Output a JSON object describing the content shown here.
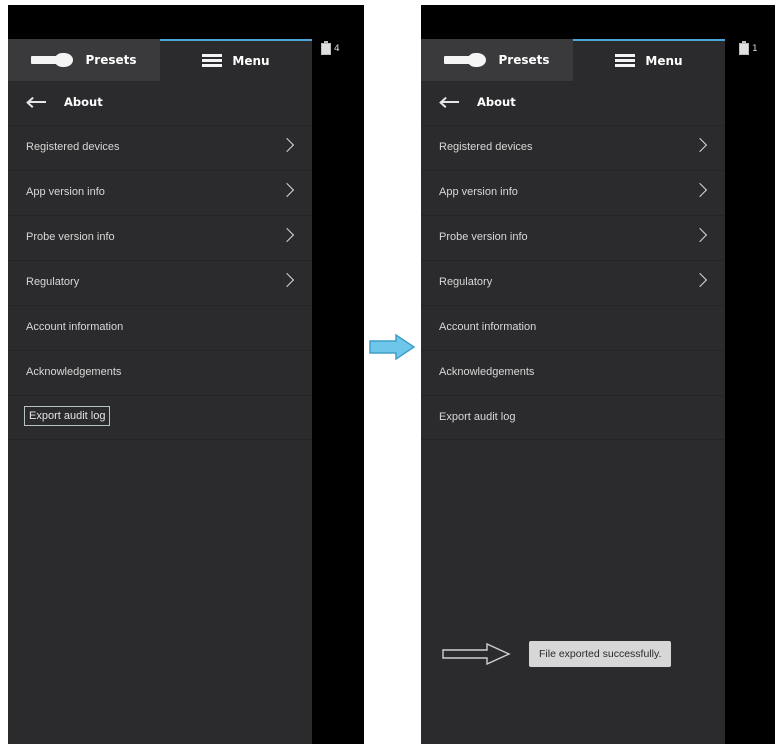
{
  "left_screen": {
    "tabs": {
      "presets_label": "Presets",
      "menu_label": "Menu"
    },
    "badge_count": "4",
    "header": {
      "title": "About"
    },
    "items": [
      {
        "label": "Registered devices",
        "chevron": true
      },
      {
        "label": "App version info",
        "chevron": true
      },
      {
        "label": "Probe version info",
        "chevron": true
      },
      {
        "label": "Regulatory",
        "chevron": true
      },
      {
        "label": "Account information",
        "chevron": false
      },
      {
        "label": "Acknowledgements",
        "chevron": false
      },
      {
        "label": "Export audit log",
        "chevron": false,
        "focused": true
      }
    ]
  },
  "right_screen": {
    "tabs": {
      "presets_label": "Presets",
      "menu_label": "Menu"
    },
    "badge_count": "1",
    "header": {
      "title": "About"
    },
    "items": [
      {
        "label": "Registered devices",
        "chevron": true
      },
      {
        "label": "App version info",
        "chevron": true
      },
      {
        "label": "Probe version info",
        "chevron": true
      },
      {
        "label": "Regulatory",
        "chevron": true
      },
      {
        "label": "Account information",
        "chevron": false
      },
      {
        "label": "Acknowledgements",
        "chevron": false
      },
      {
        "label": "Export audit log",
        "chevron": false
      }
    ],
    "toast": {
      "message": "File exported successfully."
    }
  },
  "icons": {
    "back": "back-arrow-icon",
    "chevron": "chevron-right-icon",
    "menu": "hamburger-menu-icon",
    "probe": "probe-icon",
    "clipboard": "clipboard-icon",
    "transition": "right-arrow-icon"
  },
  "colors": {
    "panel": "#2b2b2d",
    "active_tab_indicator": "#4aa6d6",
    "transition_arrow": "#6ec6ea",
    "toast_bg": "#d7d7d7"
  }
}
